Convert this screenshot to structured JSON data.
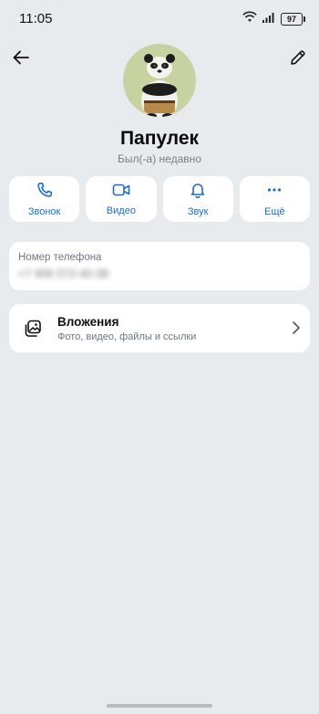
{
  "status_bar": {
    "time": "11:05",
    "battery": "97",
    "icons": [
      "wifi-icon",
      "signal-icon",
      "battery-icon"
    ]
  },
  "nav": {
    "back_icon": "arrow-left-icon",
    "edit_icon": "pencil-icon"
  },
  "profile": {
    "name": "Папулек",
    "status": "Был(-а) недавно",
    "avatar": "panda-avatar"
  },
  "actions": [
    {
      "label": "Звонок",
      "icon": "phone-icon"
    },
    {
      "label": "Видео",
      "icon": "video-camera-icon"
    },
    {
      "label": "Звук",
      "icon": "bell-icon"
    },
    {
      "label": "Ещё",
      "icon": "more-dots-icon"
    }
  ],
  "phone": {
    "caption": "Номер телефона",
    "value": "+7 906 072-40-38"
  },
  "attachments": {
    "title": "Вложения",
    "subtitle": "Фото, видео, файлы и ссылки",
    "icon": "gallery-icon"
  },
  "colors": {
    "background": "#e8ebee",
    "card": "#ffffff",
    "accent": "#1b6fd0",
    "secondary_text": "#6f7680"
  }
}
